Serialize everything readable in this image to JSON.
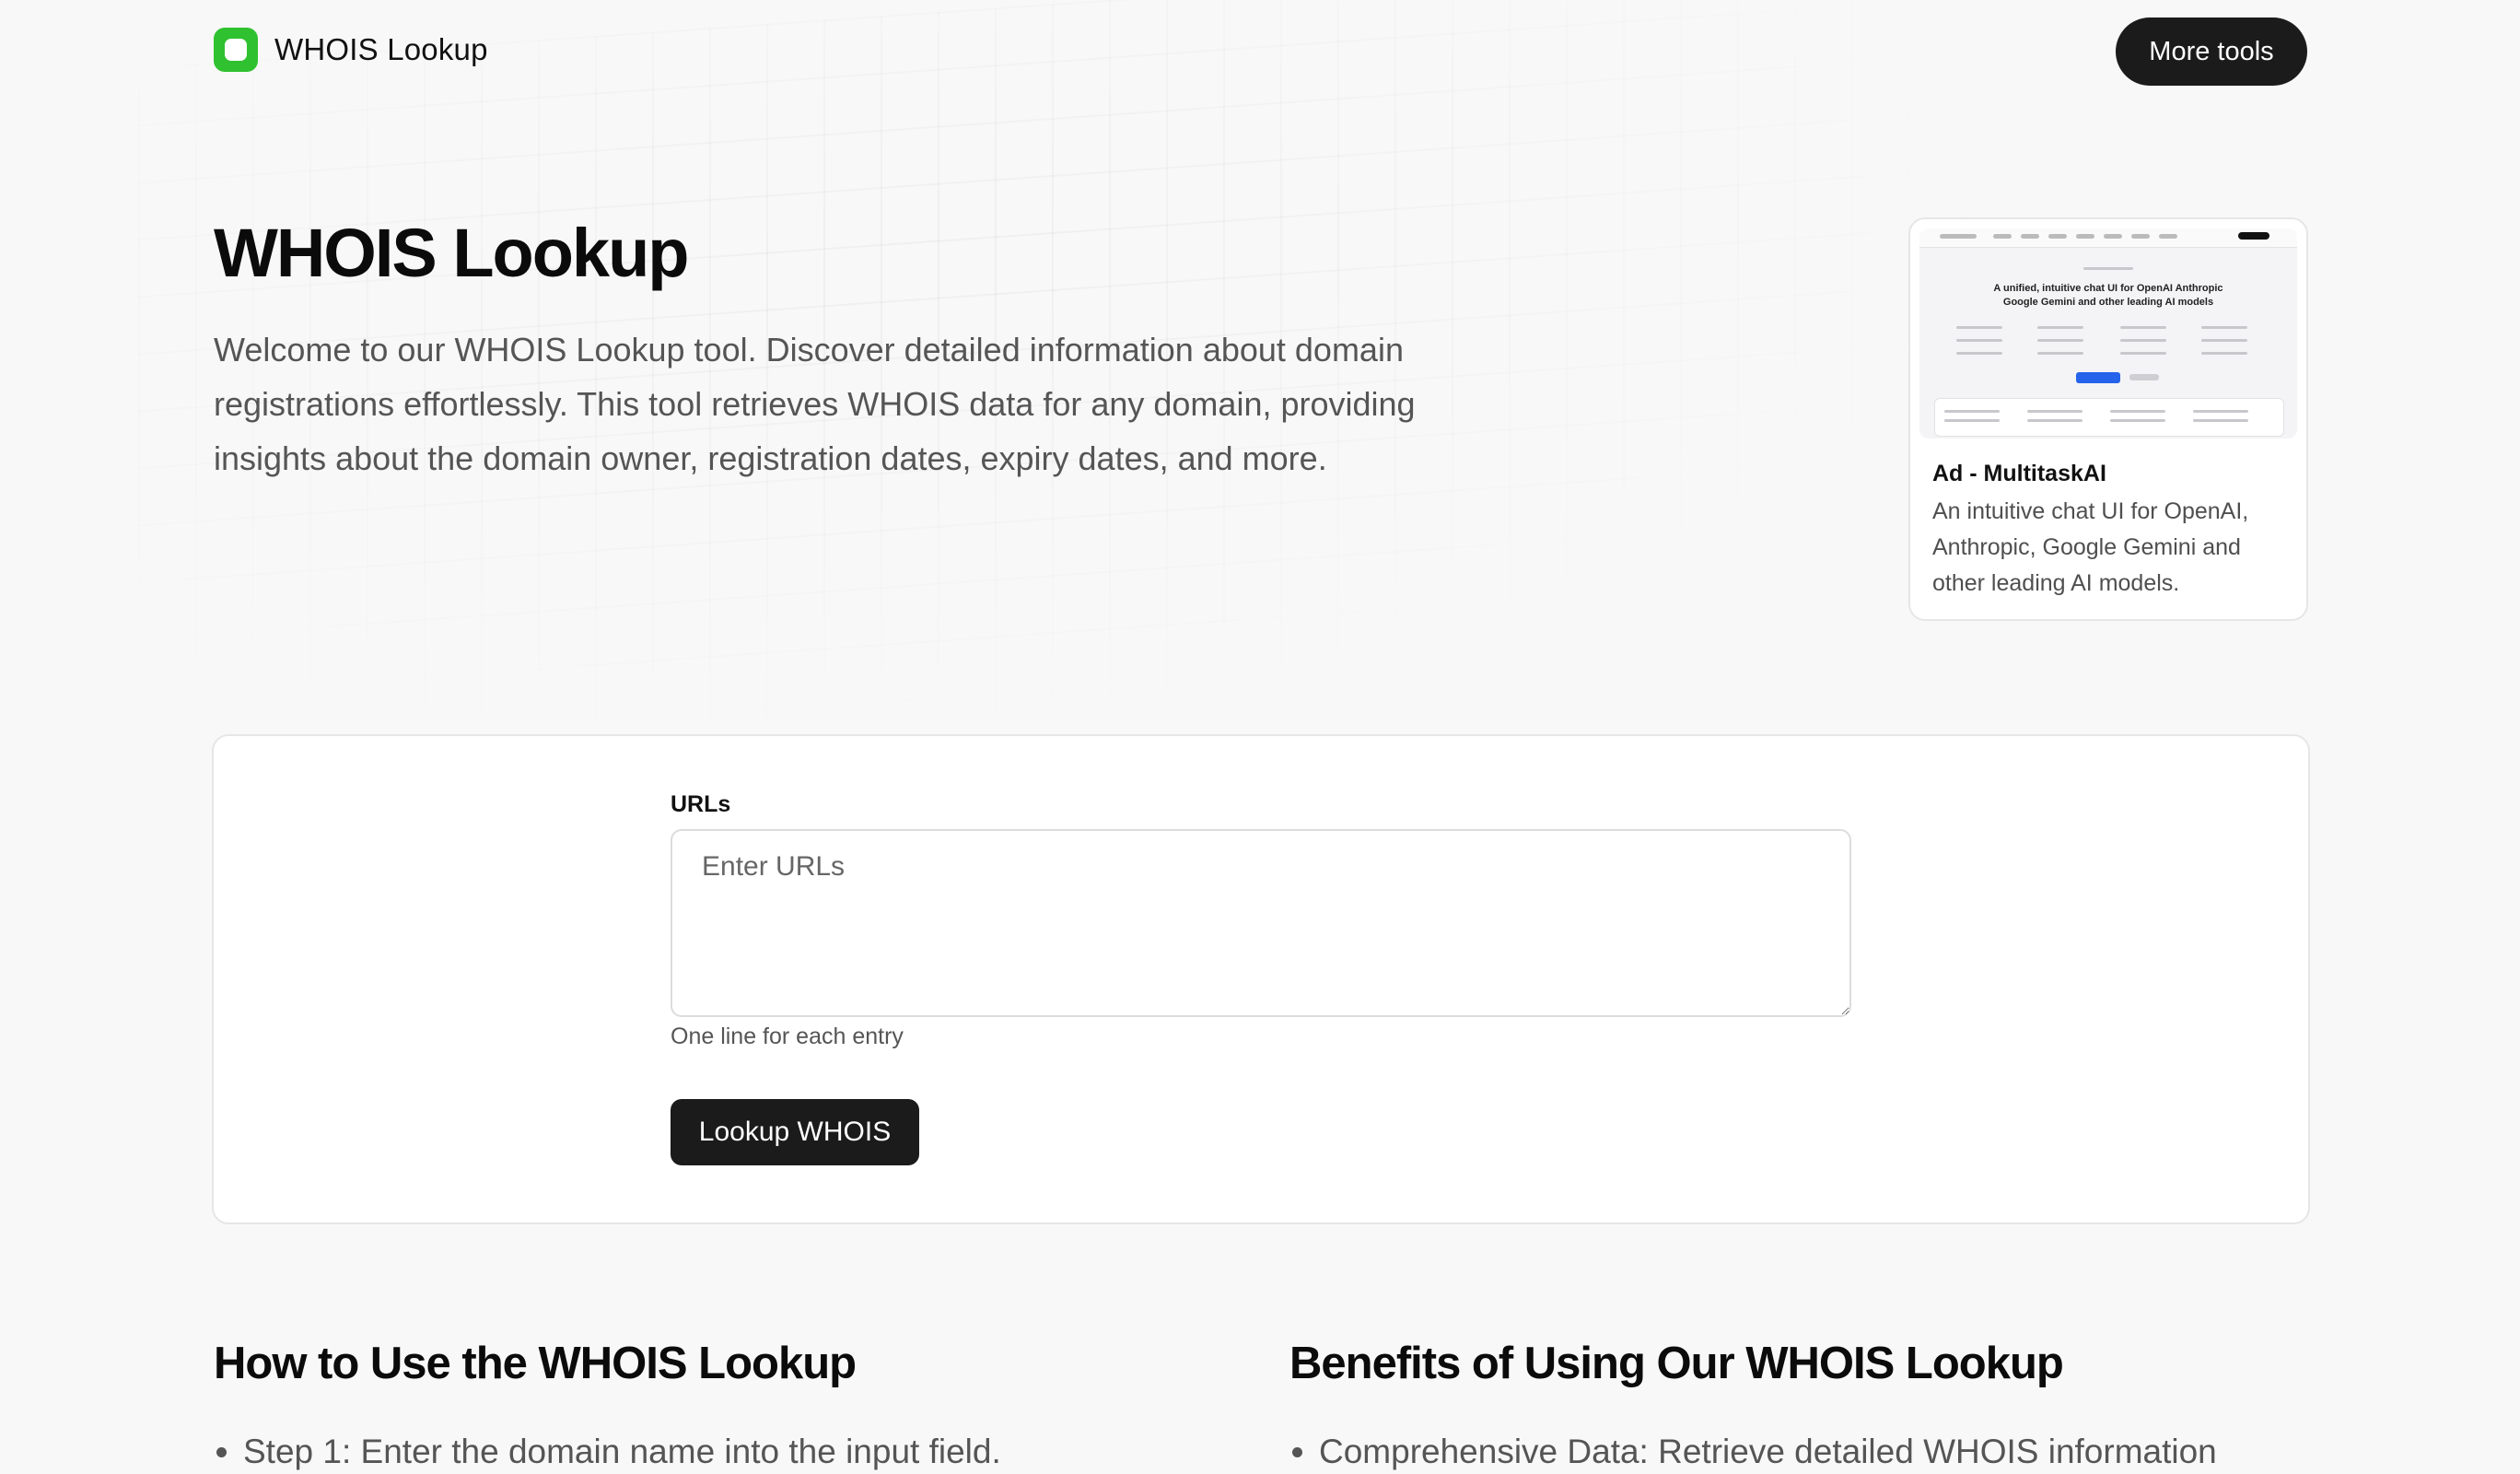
{
  "header": {
    "brand": "WHOIS Lookup",
    "more_tools": "More tools"
  },
  "hero": {
    "title": "WHOIS Lookup",
    "description": "Welcome to our WHOIS Lookup tool. Discover detailed information about domain registrations effortlessly. This tool retrieves WHOIS data for any domain, providing insights about the domain owner, registration dates, expiry dates, and more."
  },
  "ad": {
    "title": "Ad - MultitaskAI",
    "description": "An intuitive chat UI for OpenAI, Anthropic, Google Gemini and other leading AI models.",
    "preview_headline_1": "A unified, intuitive chat UI for OpenAI Anthropic",
    "preview_headline_2": "Google Gemini and other leading AI models"
  },
  "form": {
    "label": "URLs",
    "placeholder": "Enter URLs",
    "help": "One line for each entry",
    "submit": "Lookup WHOIS"
  },
  "how_to": {
    "title": "How to Use the WHOIS Lookup",
    "items": [
      "Step 1: Enter the domain name into the input field."
    ]
  },
  "benefits": {
    "title": "Benefits of Using Our WHOIS Lookup",
    "items": [
      "Comprehensive Data: Retrieve detailed WHOIS information"
    ]
  },
  "colors": {
    "brand_green": "#2fc12f",
    "button_dark": "#1b1b1b",
    "background": "#f8f8f8"
  }
}
